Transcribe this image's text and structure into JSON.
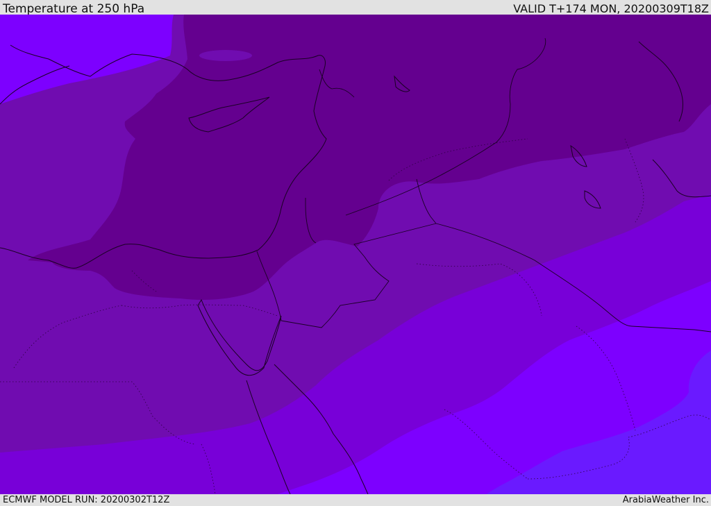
{
  "header": {
    "title": "Temperature at 250 hPa",
    "valid": "VALID T+174 MON, 20200309T18Z"
  },
  "footer": {
    "model_run": "ECMWF MODEL RUN: 20200302T12Z",
    "credit": "ArabiaWeather Inc."
  },
  "map": {
    "field": "temperature",
    "level": "250 hPa",
    "colors": {
      "coldest": "#64008f",
      "cold": "#700cb0",
      "mid": "#7800d8",
      "warm": "#7d00ff",
      "warmest": "#6a1aff"
    }
  }
}
